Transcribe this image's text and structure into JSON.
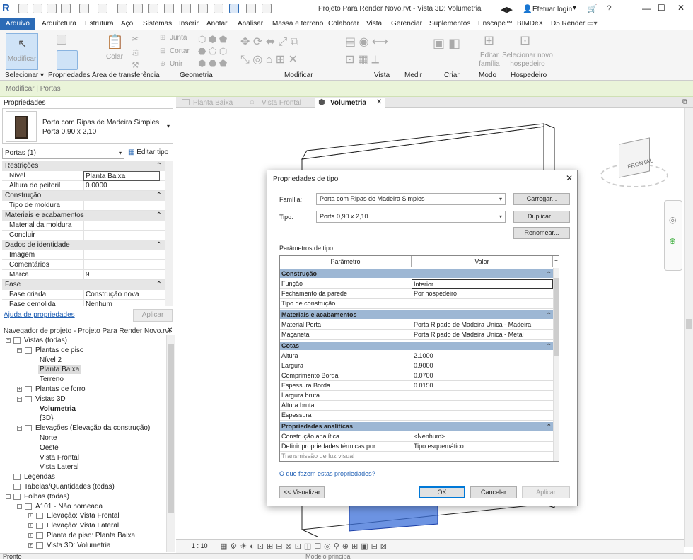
{
  "window": {
    "title": "Projeto Para Render Novo.rvt - Vista 3D: Volumetria",
    "login": "Efetuar login"
  },
  "ribbon_tabs": [
    "Arquivo",
    "Arquitetura",
    "Estrutura",
    "Aço",
    "Sistemas",
    "Inserir",
    "Anotar",
    "Analisar",
    "Massa e terreno",
    "Colaborar",
    "Vista",
    "Gerenciar",
    "Suplementos",
    "Enscape™",
    "BIMDeX",
    "D5 Render"
  ],
  "ribbon": {
    "modificar": "Modificar",
    "colar": "Colar",
    "junta": "Junta",
    "cortar": "Cortar",
    "unir": "Unir",
    "editar_familia": "Editar família",
    "selecionar_hospedeiro": "Selecionar novo hospedeiro",
    "panels": {
      "selecionar": "Selecionar",
      "propriedades": "Propriedades",
      "area": "Área de transferência",
      "geometria": "Geometria",
      "modificar": "Modificar",
      "vista": "Vista",
      "medir": "Medir",
      "criar": "Criar",
      "modo": "Modo",
      "hospedeiro": "Hospedeiro"
    }
  },
  "options_bar": "Modificar | Portas",
  "properties": {
    "title": "Propriedades",
    "type_name": "Porta com Ripas de Madeira Simples",
    "type_size": "Porta 0,90 x 2,10",
    "filter": "Portas (1)",
    "edit_type": "Editar tipo",
    "help": "Ajuda de propriedades",
    "apply": "Aplicar",
    "sections": [
      {
        "name": "Restrições",
        "rows": [
          [
            "Nível",
            "Planta Baixa"
          ],
          [
            "Altura do peitoril",
            "0.0000"
          ]
        ]
      },
      {
        "name": "Construção",
        "rows": [
          [
            "Tipo de moldura",
            ""
          ]
        ]
      },
      {
        "name": "Materiais e acabamentos",
        "rows": [
          [
            "Material da moldura",
            ""
          ],
          [
            "Concluir",
            ""
          ]
        ]
      },
      {
        "name": "Dados de identidade",
        "rows": [
          [
            "Imagem",
            ""
          ],
          [
            "Comentários",
            ""
          ],
          [
            "Marca",
            "9"
          ]
        ]
      },
      {
        "name": "Fase",
        "rows": [
          [
            "Fase criada",
            "Construção nova"
          ],
          [
            "Fase demolida",
            "Nenhum"
          ]
        ]
      }
    ]
  },
  "navigator": {
    "title": "Navegador de projeto - Projeto Para Render Novo.rvt",
    "items": [
      {
        "label": "Vistas (todas)",
        "level": 0,
        "exp": "-"
      },
      {
        "label": "Plantas de piso",
        "level": 1,
        "exp": "-"
      },
      {
        "label": "Nível 2",
        "level": 2,
        "exp": ""
      },
      {
        "label": "Planta Baixa",
        "level": 2,
        "exp": "",
        "selected": true
      },
      {
        "label": "Terreno",
        "level": 2,
        "exp": ""
      },
      {
        "label": "Plantas de forro",
        "level": 1,
        "exp": "+"
      },
      {
        "label": "Vistas 3D",
        "level": 1,
        "exp": "-"
      },
      {
        "label": "Volumetria",
        "level": 2,
        "exp": "",
        "bold": true
      },
      {
        "label": "{3D}",
        "level": 2,
        "exp": ""
      },
      {
        "label": "Elevações (Elevação da construção)",
        "level": 1,
        "exp": "-"
      },
      {
        "label": "Norte",
        "level": 2,
        "exp": ""
      },
      {
        "label": "Oeste",
        "level": 2,
        "exp": ""
      },
      {
        "label": "Vista Frontal",
        "level": 2,
        "exp": ""
      },
      {
        "label": "Vista Lateral",
        "level": 2,
        "exp": ""
      },
      {
        "label": "Legendas",
        "level": 0,
        "exp": ""
      },
      {
        "label": "Tabelas/Quantidades (todas)",
        "level": 0,
        "exp": ""
      },
      {
        "label": "Folhas (todas)",
        "level": 0,
        "exp": "-"
      },
      {
        "label": "A101 - Não nomeada",
        "level": 1,
        "exp": "-"
      },
      {
        "label": "Elevação: Vista Frontal",
        "level": 2,
        "exp": "+"
      },
      {
        "label": "Elevação: Vista Lateral",
        "level": 2,
        "exp": "+"
      },
      {
        "label": "Planta de piso: Planta Baixa",
        "level": 2,
        "exp": "+"
      },
      {
        "label": "Vista 3D: Volumetria",
        "level": 2,
        "exp": "+"
      }
    ]
  },
  "view_tabs": [
    {
      "label": "Planta Baixa",
      "active": false
    },
    {
      "label": "Vista Frontal",
      "active": false
    },
    {
      "label": "Volumetria",
      "active": true
    }
  ],
  "viewcube_label": "FRONTAL",
  "scale": "1 : 10",
  "status": {
    "left": "Pronto",
    "model": "Modelo principal"
  },
  "dialog": {
    "title": "Propriedades de tipo",
    "familia_label": "Família:",
    "familia_value": "Porta com Ripas de Madeira Simples",
    "tipo_label": "Tipo:",
    "tipo_value": "Porta 0,90 x 2,10",
    "carregar": "Carregar...",
    "duplicar": "Duplicar...",
    "renomear": "Renomear...",
    "params_label": "Parâmetros de tipo",
    "col_param": "Parâmetro",
    "col_valor": "Valor",
    "groups": [
      {
        "name": "Construção",
        "rows": [
          [
            "Função",
            "Interior"
          ],
          [
            "Fechamento da parede",
            "Por hospedeiro"
          ],
          [
            "Tipo de construção",
            ""
          ]
        ]
      },
      {
        "name": "Materiais e acabamentos",
        "rows": [
          [
            "Material Porta",
            "Porta Ripado de Madeira Unica - Madeira"
          ],
          [
            "Maçaneta",
            "Porta Ripado de Madeira Unica - Metal"
          ]
        ]
      },
      {
        "name": "Cotas",
        "rows": [
          [
            "Altura",
            "2.1000"
          ],
          [
            "Largura",
            "0.9000"
          ],
          [
            "Comprimento Borda",
            "0.0700"
          ],
          [
            "Espessura Borda",
            "0.0150"
          ],
          [
            "Largura bruta",
            ""
          ],
          [
            "Altura bruta",
            ""
          ],
          [
            "Espessura",
            ""
          ]
        ]
      },
      {
        "name": "Propriedades analíticas",
        "rows": [
          [
            "Construção analítica",
            "<Nenhum>"
          ],
          [
            "Definir propriedades térmicas por",
            "Tipo esquemático"
          ],
          [
            "Transmissão de luz visual",
            ""
          ]
        ]
      }
    ],
    "help_link": "O que fazem estas propriedades?",
    "preview": "<< Visualizar",
    "ok": "OK",
    "cancelar": "Cancelar",
    "aplicar": "Aplicar"
  },
  "colors": {
    "accent": "#2c6bb6",
    "group": "#9db7d4",
    "option_bar": "#eaf4d9",
    "selection": "#3b6fd8"
  }
}
